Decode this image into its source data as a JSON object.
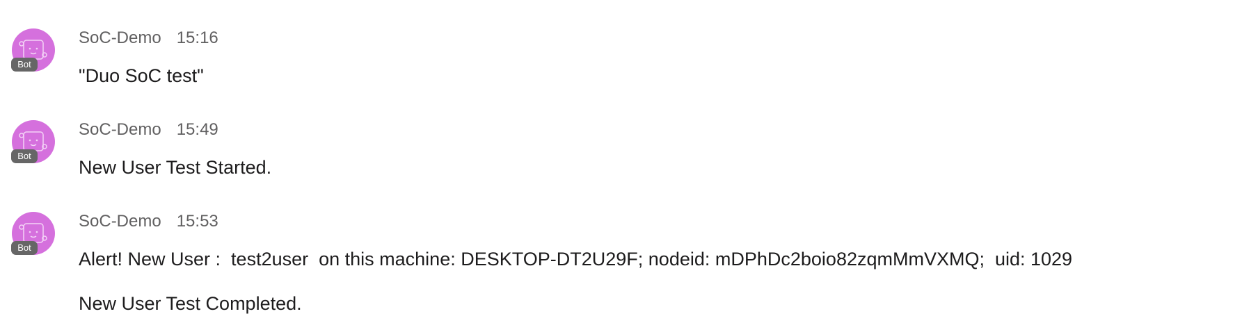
{
  "messages": [
    {
      "sender": "SoC-Demo",
      "time": "15:16",
      "badge": "Bot",
      "lines": [
        "\"Duo SoC test\""
      ]
    },
    {
      "sender": "SoC-Demo",
      "time": "15:49",
      "badge": "Bot",
      "lines": [
        "New User Test Started."
      ]
    },
    {
      "sender": "SoC-Demo",
      "time": "15:53",
      "badge": "Bot",
      "lines": [
        "Alert! New User :  test2user  on this machine: DESKTOP-DT2U29F; nodeid: mDPhDc2boio82zqmMmVXMQ;  uid: 1029",
        "New User Test Completed."
      ]
    }
  ],
  "colors": {
    "avatar_bg": "#d570dd",
    "badge_bg": "#666666",
    "meta_text": "#616061",
    "body_text": "#1d1c1d"
  },
  "icons": {
    "avatar": "bot-face-icon"
  }
}
